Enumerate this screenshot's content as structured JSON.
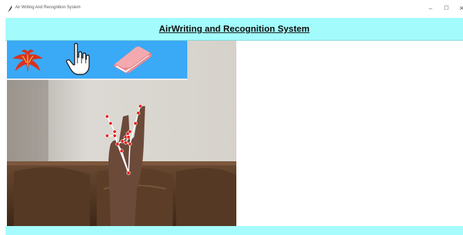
{
  "window": {
    "title": "Air Writing And Recognition System",
    "minimize_glyph": "–",
    "maximize_glyph": "☐",
    "close_glyph": "✕"
  },
  "header": {
    "title": "AirWriting and Recognition System"
  },
  "toolbar": {
    "tools": [
      {
        "name": "bird-logo",
        "icon": "phoenix-icon"
      },
      {
        "name": "draw-hand",
        "icon": "pointing-hand-icon"
      },
      {
        "name": "eraser",
        "icon": "eraser-icon"
      }
    ]
  },
  "colors": {
    "header_bg": "#a3fbfb",
    "toolbar_bg": "#3aa9f6",
    "canvas_bg": "#ffffff",
    "landmark_line": "#ffffff",
    "landmark_point": "#e8261e"
  }
}
